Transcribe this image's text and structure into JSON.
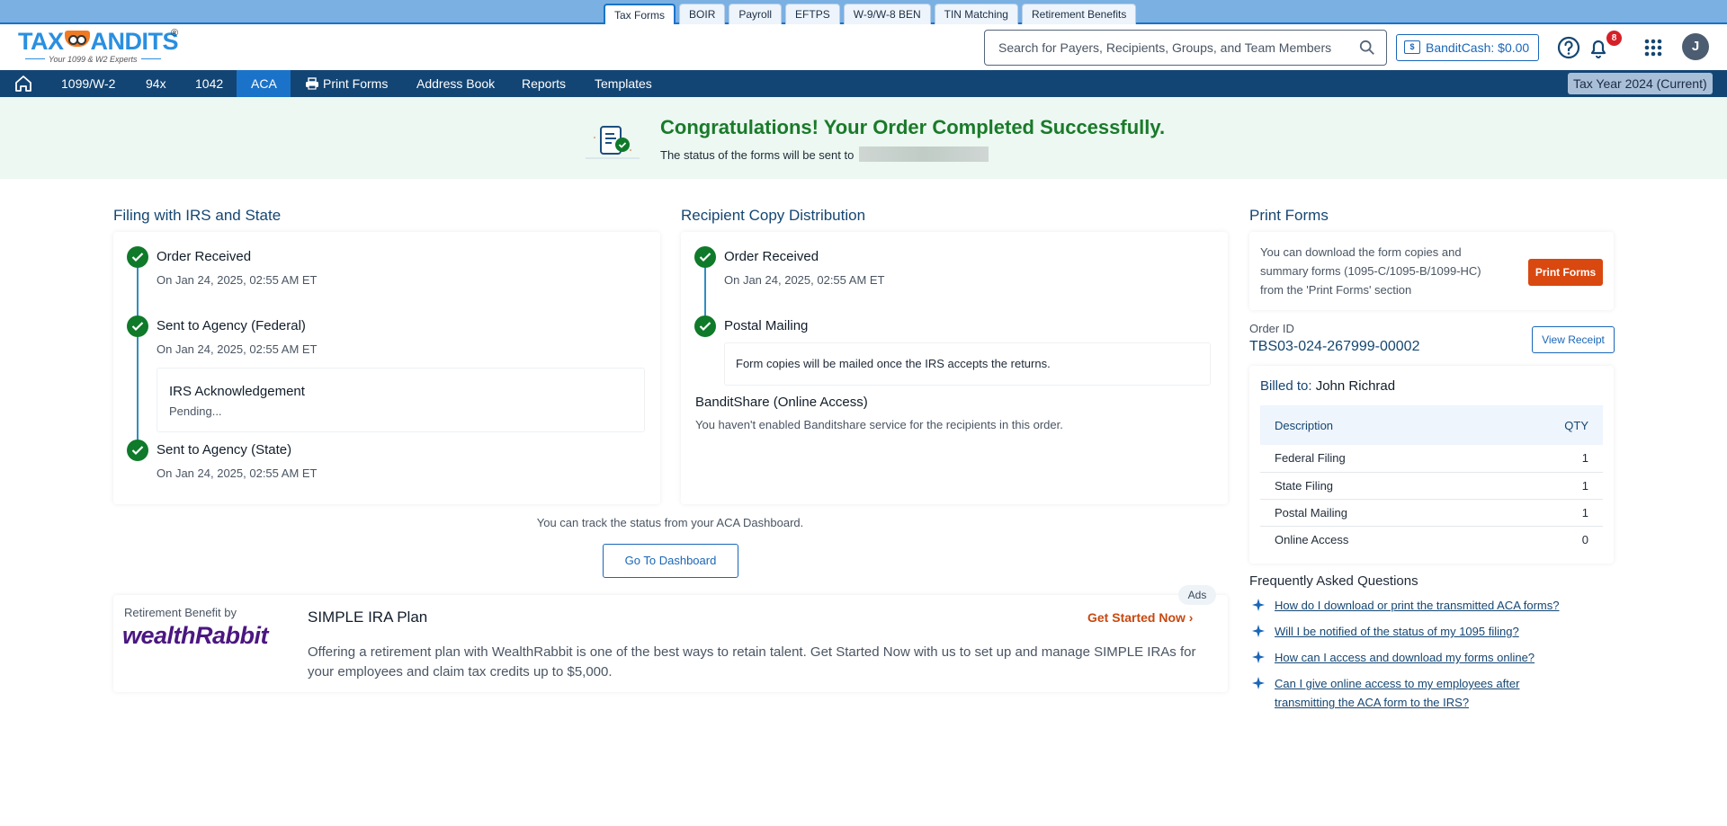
{
  "product_tabs": [
    {
      "label": "Tax Forms",
      "active": true
    },
    {
      "label": "BOIR",
      "active": false
    },
    {
      "label": "Payroll",
      "active": false
    },
    {
      "label": "EFTPS",
      "active": false
    },
    {
      "label": "W-9/W-8 BEN",
      "active": false
    },
    {
      "label": "TIN Matching",
      "active": false
    },
    {
      "label": "Retirement Benefits",
      "active": false
    }
  ],
  "logo": {
    "brand_left": "TAX",
    "brand_right": "ANDITS",
    "registered": "®",
    "tagline": "Your 1099 & W2 Experts"
  },
  "search": {
    "placeholder": "Search for Payers, Recipients, Groups, and Team Members",
    "value": ""
  },
  "bandit_cash": {
    "label": "BanditCash: $0.00",
    "icon": "wallet-icon"
  },
  "notifications": {
    "count": "8"
  },
  "user": {
    "initial": "J"
  },
  "nav": {
    "items": [
      {
        "label": "1099/W-2",
        "active": false
      },
      {
        "label": "94x",
        "active": false
      },
      {
        "label": "1042",
        "active": false
      },
      {
        "label": "ACA",
        "active": true
      },
      {
        "label": "Print Forms",
        "active": false,
        "icon": "printer-icon"
      },
      {
        "label": "Address Book",
        "active": false
      },
      {
        "label": "Reports",
        "active": false
      },
      {
        "label": "Templates",
        "active": false
      }
    ],
    "tax_year": "Tax Year 2024 (Current)"
  },
  "banner": {
    "title": "Congratulations! Your Order Completed Successfully.",
    "subtitle": "The status of the forms will be sent to"
  },
  "filing": {
    "title": "Filing with IRS and State",
    "steps": [
      {
        "title": "Order Received",
        "date": "On Jan 24, 2025, 02:55 AM ET"
      },
      {
        "title": "Sent to Agency (Federal)",
        "date": "On Jan 24, 2025, 02:55 AM ET"
      },
      {
        "title": "Sent to Agency (State)",
        "date": "On Jan 24, 2025, 02:55 AM ET"
      }
    ],
    "ack": {
      "title": "IRS Acknowledgement",
      "status": "Pending..."
    }
  },
  "recipient": {
    "title": "Recipient Copy Distribution",
    "steps": [
      {
        "title": "Order Received",
        "date": "On Jan 24, 2025, 02:55 AM ET"
      },
      {
        "title": "Postal Mailing",
        "note": "Form copies will be mailed once the IRS accepts the returns."
      }
    ],
    "banditshare": {
      "title": "BanditShare (Online Access)",
      "text": "You haven't enabled Banditshare service for the recipients in this order."
    }
  },
  "track": {
    "text": "You can track the status from your ACA Dashboard.",
    "button": "Go To Dashboard"
  },
  "ad": {
    "tag": "Ads",
    "provider_label": "Retirement Benefit by",
    "provider_logo": "wealthRabbit",
    "title": "SIMPLE IRA Plan",
    "cta": "Get Started Now",
    "body": "Offering a retirement plan with WealthRabbit is one of the best ways to retain talent. Get Started Now with us to set up and manage SIMPLE IRAs for your employees and claim tax credits up to $5,000."
  },
  "print_forms": {
    "title": "Print Forms",
    "text": "You can download the form copies and summary forms (1095-C/1095-B/1099-HC) from the 'Print Forms' section",
    "button": "Print Forms"
  },
  "order": {
    "label": "Order ID",
    "id": "TBS03-024-267999-00002",
    "receipt_button": "View Receipt"
  },
  "billing": {
    "billed_to_label": "Billed to:",
    "billed_to_name": "John Richrad",
    "columns": [
      "Description",
      "QTY"
    ],
    "rows": [
      {
        "description": "Federal Filing",
        "qty": "1"
      },
      {
        "description": "State Filing",
        "qty": "1"
      },
      {
        "description": "Postal Mailing",
        "qty": "1"
      },
      {
        "description": "Online Access",
        "qty": "0"
      }
    ]
  },
  "faq": {
    "title": "Frequently Asked Questions",
    "items": [
      "How do I download or print the transmitted ACA forms?",
      "Will I be notified of the status of my 1095 filing?",
      "How can I access and download my forms online?",
      "Can I give online access to my employees after transmitting the ACA form to the IRS?"
    ]
  },
  "colors": {
    "nav_bg": "#134574",
    "active_blue": "#1a73c9",
    "success_green": "#0f7a2a",
    "accent_orange": "#d9480f"
  }
}
